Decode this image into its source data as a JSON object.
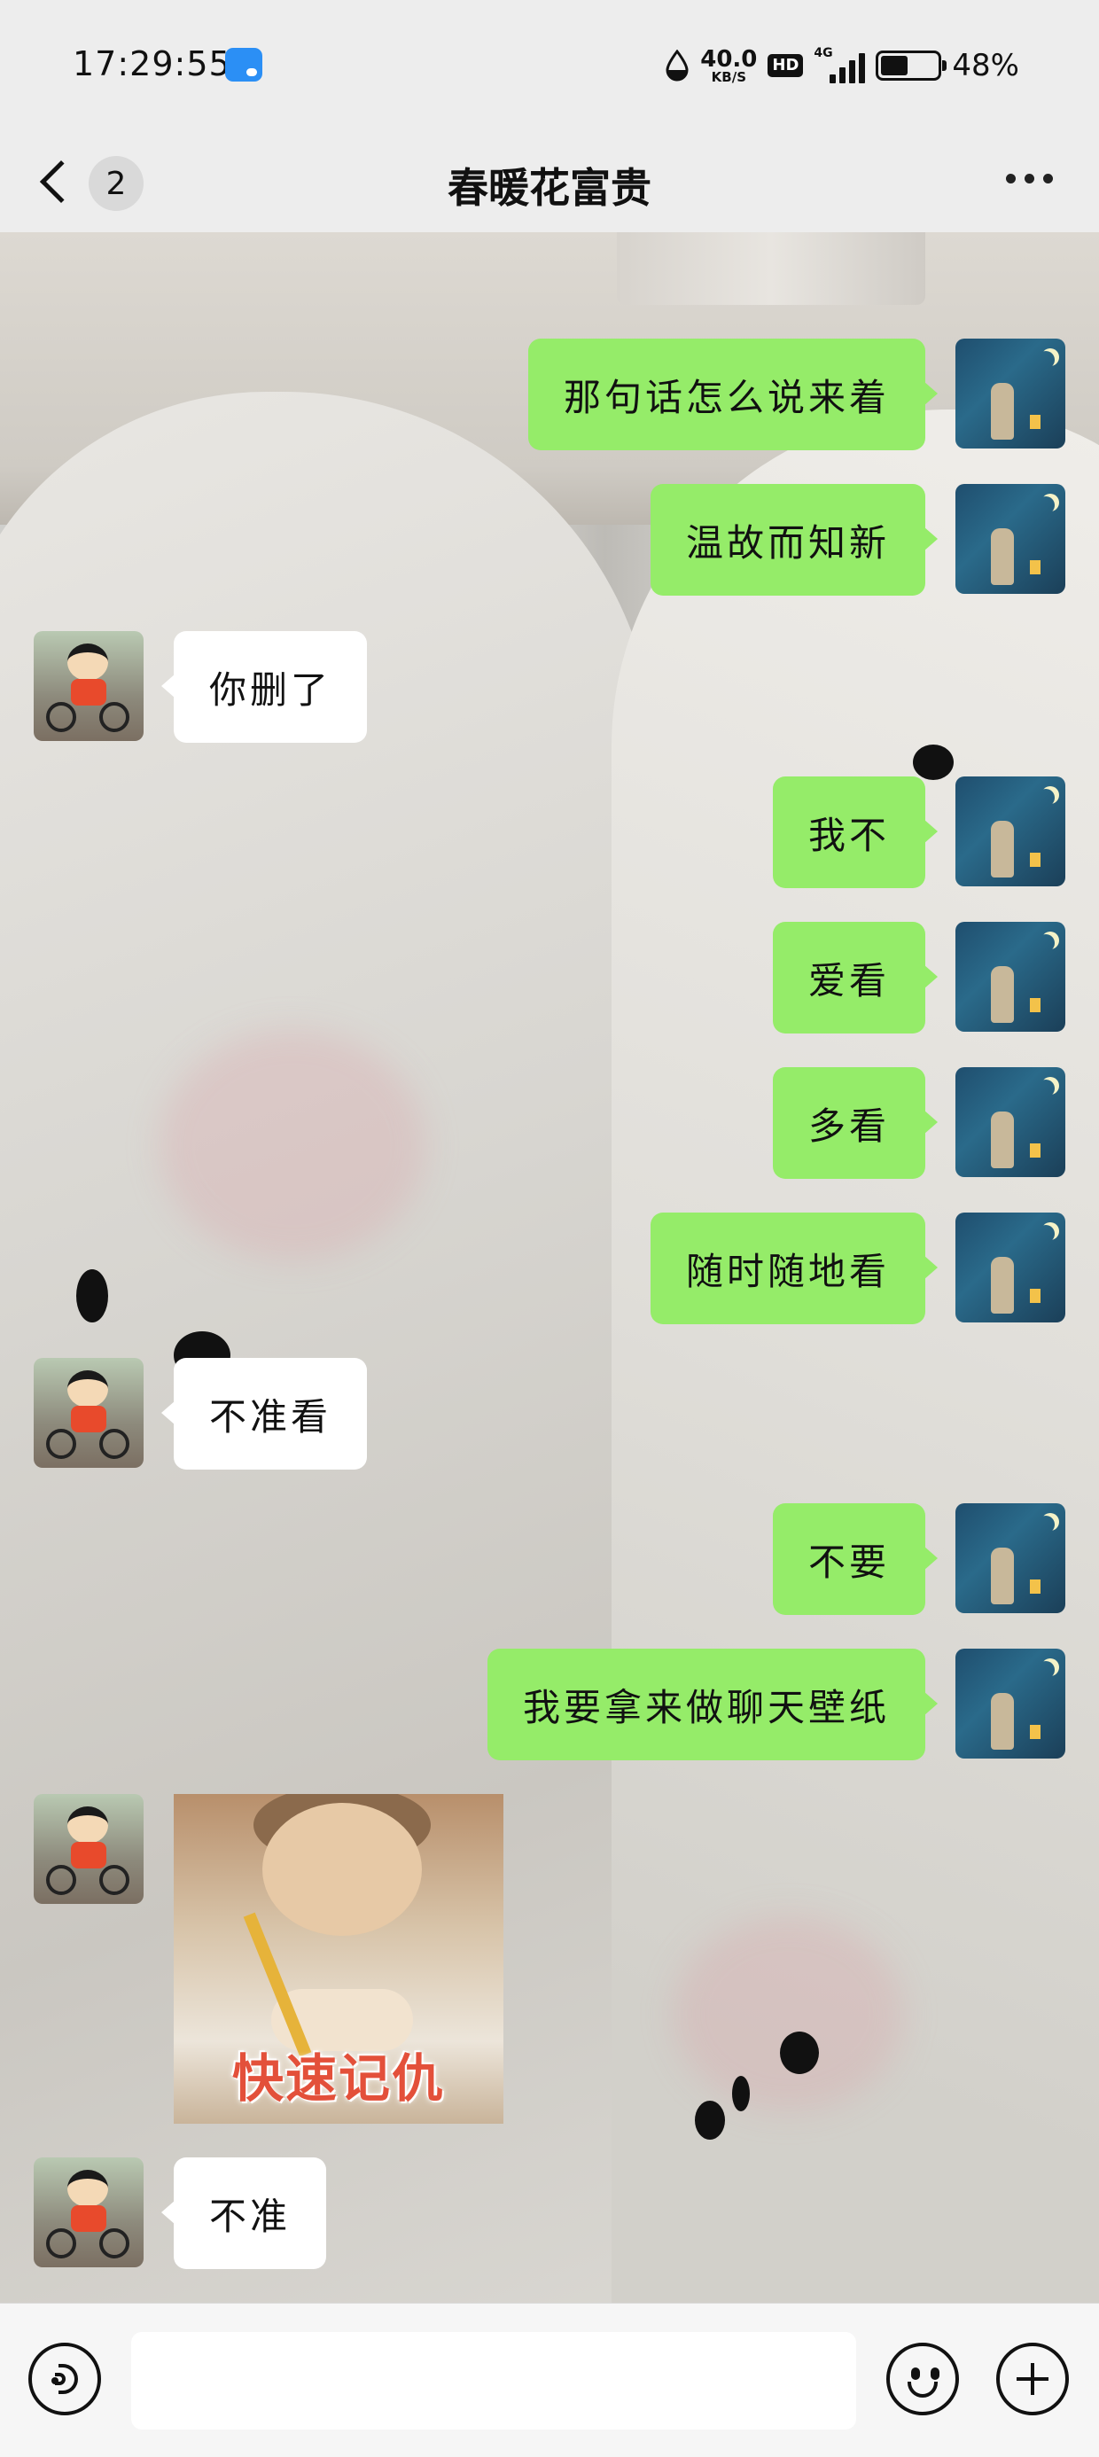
{
  "status_bar": {
    "time": "17:29:55",
    "net_speed_value": "40.0",
    "net_speed_unit": "KB/S",
    "hd_label": "HD",
    "signal_label": "4G",
    "battery_percent": "48%",
    "battery_level": 0.48
  },
  "nav": {
    "unread_count": "2",
    "title": "春暖花富贵"
  },
  "messages": [
    {
      "side": "out",
      "text": "那句话怎么说来着"
    },
    {
      "side": "out",
      "text": "温故而知新"
    },
    {
      "side": "in",
      "text": "你删了"
    },
    {
      "side": "out",
      "text": "我不"
    },
    {
      "side": "out",
      "text": "爱看"
    },
    {
      "side": "out",
      "text": "多看"
    },
    {
      "side": "out",
      "text": "随时随地看"
    },
    {
      "side": "in",
      "text": "不准看"
    },
    {
      "side": "out",
      "text": "不要"
    },
    {
      "side": "out",
      "text": "我要拿来做聊天壁纸"
    },
    {
      "side": "in",
      "type": "sticker",
      "text": "快速记仇"
    },
    {
      "side": "in",
      "text": "不准"
    }
  ],
  "input": {
    "placeholder": ""
  },
  "icons": {
    "back": "chevron-left-icon",
    "more": "more-dots-icon",
    "voice": "voice-icon",
    "emoji": "emoji-icon",
    "plus": "plus-icon"
  },
  "colors": {
    "outgoing_bubble": "#95ec69",
    "incoming_bubble": "#ffffff",
    "bar_background": "#ededed"
  }
}
